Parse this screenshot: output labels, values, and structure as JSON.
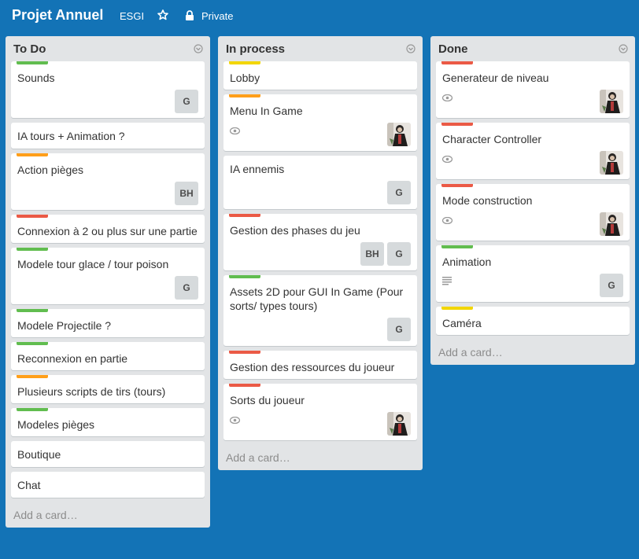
{
  "board": {
    "title": "Projet Annuel",
    "org": "ESGI",
    "privacy": "Private",
    "background": "#1373b6"
  },
  "label_colors": {
    "green": "#61bd4f",
    "yellow": "#f2d600",
    "orange": "#ff9f1a",
    "red": "#eb5a46"
  },
  "lists": [
    {
      "title": "To Do",
      "add_card": "Add a card…",
      "cards": [
        {
          "title": "Sounds",
          "label": "green",
          "members": [
            "G"
          ]
        },
        {
          "title": "IA tours + Animation ?"
        },
        {
          "title": "Action pièges",
          "label": "orange",
          "members": [
            "BH"
          ]
        },
        {
          "title": "Connexion à 2 ou plus sur une partie",
          "label": "red"
        },
        {
          "title": "Modele tour glace / tour poison",
          "label": "green",
          "members": [
            "G"
          ]
        },
        {
          "title": "Modele Projectile ?",
          "label": "green"
        },
        {
          "title": "Reconnexion en partie",
          "label": "green"
        },
        {
          "title": "Plusieurs scripts de tirs (tours)",
          "label": "orange"
        },
        {
          "title": "Modeles pièges",
          "label": "green"
        },
        {
          "title": "Boutique"
        },
        {
          "title": "Chat"
        }
      ]
    },
    {
      "title": "In process",
      "add_card": "Add a card…",
      "cards": [
        {
          "title": "Lobby",
          "label": "yellow"
        },
        {
          "title": "Menu In Game",
          "label": "orange",
          "watch": true,
          "avatar": true
        },
        {
          "title": "IA ennemis",
          "members": [
            "G"
          ]
        },
        {
          "title": "Gestion des phases du jeu",
          "label": "red",
          "members": [
            "BH",
            "G"
          ]
        },
        {
          "title": "Assets 2D pour GUI In Game (Pour sorts/ types tours)",
          "label": "green",
          "members": [
            "G"
          ]
        },
        {
          "title": "Gestion des ressources du joueur",
          "label": "red"
        },
        {
          "title": "Sorts du joueur",
          "label": "red",
          "watch": true,
          "avatar": true
        }
      ]
    },
    {
      "title": "Done",
      "add_card": "Add a card…",
      "cards": [
        {
          "title": "Generateur de niveau",
          "label": "red",
          "watch": true,
          "avatar": true
        },
        {
          "title": "Character Controller",
          "label": "red",
          "watch": true,
          "avatar": true
        },
        {
          "title": "Mode construction",
          "label": "red",
          "watch": true,
          "avatar": true
        },
        {
          "title": "Animation",
          "label": "green",
          "description": true,
          "members": [
            "G"
          ]
        },
        {
          "title": "Caméra",
          "label": "yellow"
        }
      ]
    }
  ]
}
